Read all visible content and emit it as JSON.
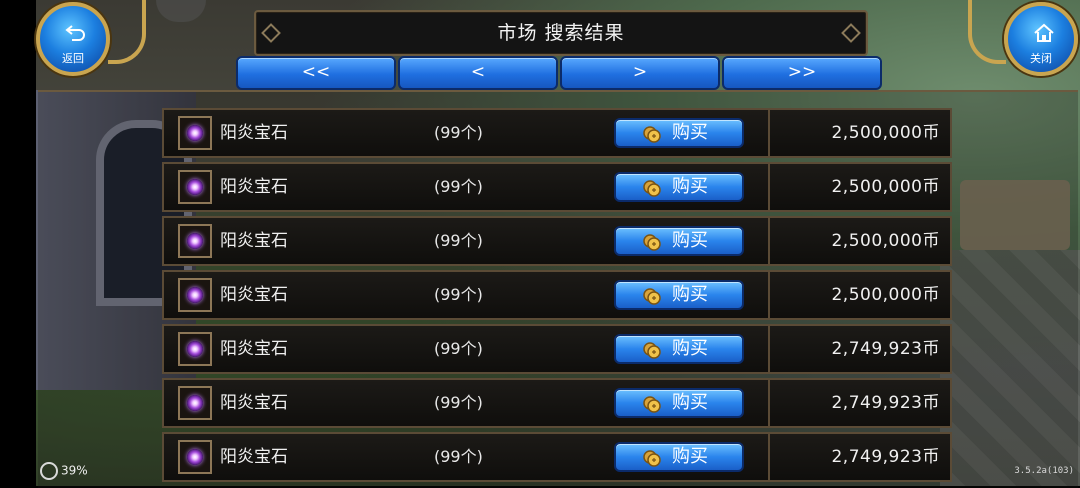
{
  "header": {
    "title": "市场 搜索结果",
    "back_label": "返回",
    "close_label": "关闭"
  },
  "pagination": {
    "first": "<<",
    "prev": "<",
    "next": ">",
    "last": ">>"
  },
  "listings": [
    {
      "name": "阳炎宝石",
      "qty": "(99个)",
      "buy": "购买",
      "price": "2,500,000币"
    },
    {
      "name": "阳炎宝石",
      "qty": "(99个)",
      "buy": "购买",
      "price": "2,500,000币"
    },
    {
      "name": "阳炎宝石",
      "qty": "(99个)",
      "buy": "购买",
      "price": "2,500,000币"
    },
    {
      "name": "阳炎宝石",
      "qty": "(99个)",
      "buy": "购买",
      "price": "2,500,000币"
    },
    {
      "name": "阳炎宝石",
      "qty": "(99个)",
      "buy": "购买",
      "price": "2,749,923币"
    },
    {
      "name": "阳炎宝石",
      "qty": "(99个)",
      "buy": "购买",
      "price": "2,749,923币"
    },
    {
      "name": "阳炎宝石",
      "qty": "(99个)",
      "buy": "购买",
      "price": "2,749,923币"
    }
  ],
  "status": {
    "signal": "39%",
    "version": "3.5.2a(103)"
  },
  "icons": {
    "item": "purple-gem-icon",
    "buy": "gold-coin-icon",
    "back": "back-arrow-icon",
    "close": "home-icon"
  },
  "colors": {
    "button_blue": "#2a84ec",
    "frame_gold": "#c9a550",
    "row_border": "#5b4b36"
  }
}
